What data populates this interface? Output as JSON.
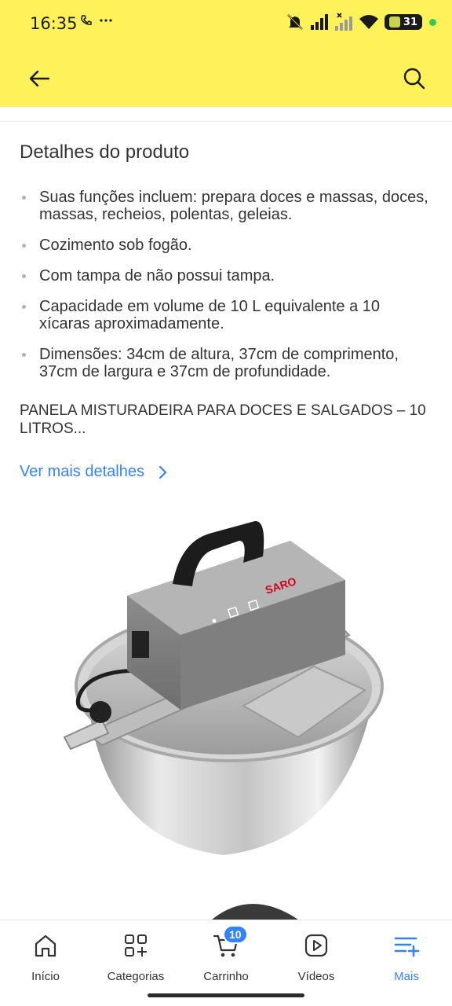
{
  "status_bar": {
    "time": "16:35",
    "battery": "31"
  },
  "colors": {
    "header_bg": "#fff159",
    "link": "#3483fa",
    "text": "#333333"
  },
  "header": {
    "back_icon": "arrow-left-icon",
    "search_icon": "search-icon"
  },
  "details": {
    "title": "Detalhes do produto",
    "items": [
      "Suas funções incluem: prepara doces e massas, doces, massas, recheios, polentas, geleias.",
      "Cozimento sob fogão.",
      "Com tampa de não possui tampa.",
      "Capacidade em volume de 10 L equivalente a 10 xícaras aproximadamente.",
      "Dimensões: 34cm de altura, 37cm de comprimento, 37cm de largura e 37cm de profundidade."
    ],
    "description": "PANELA MISTURADEIRA PARA DOCES E SALGADOS – 10 LITROS...",
    "more_link": "Ver mais detalhes"
  },
  "product_image": {
    "brand": "SARO"
  },
  "bottom_nav": {
    "items": [
      {
        "label": "Início",
        "icon": "home-icon"
      },
      {
        "label": "Categorias",
        "icon": "categories-icon"
      },
      {
        "label": "Carrinho",
        "icon": "cart-icon",
        "badge": "10"
      },
      {
        "label": "Vídeos",
        "icon": "video-icon"
      },
      {
        "label": "Mais",
        "icon": "more-icon",
        "active": true
      }
    ]
  }
}
